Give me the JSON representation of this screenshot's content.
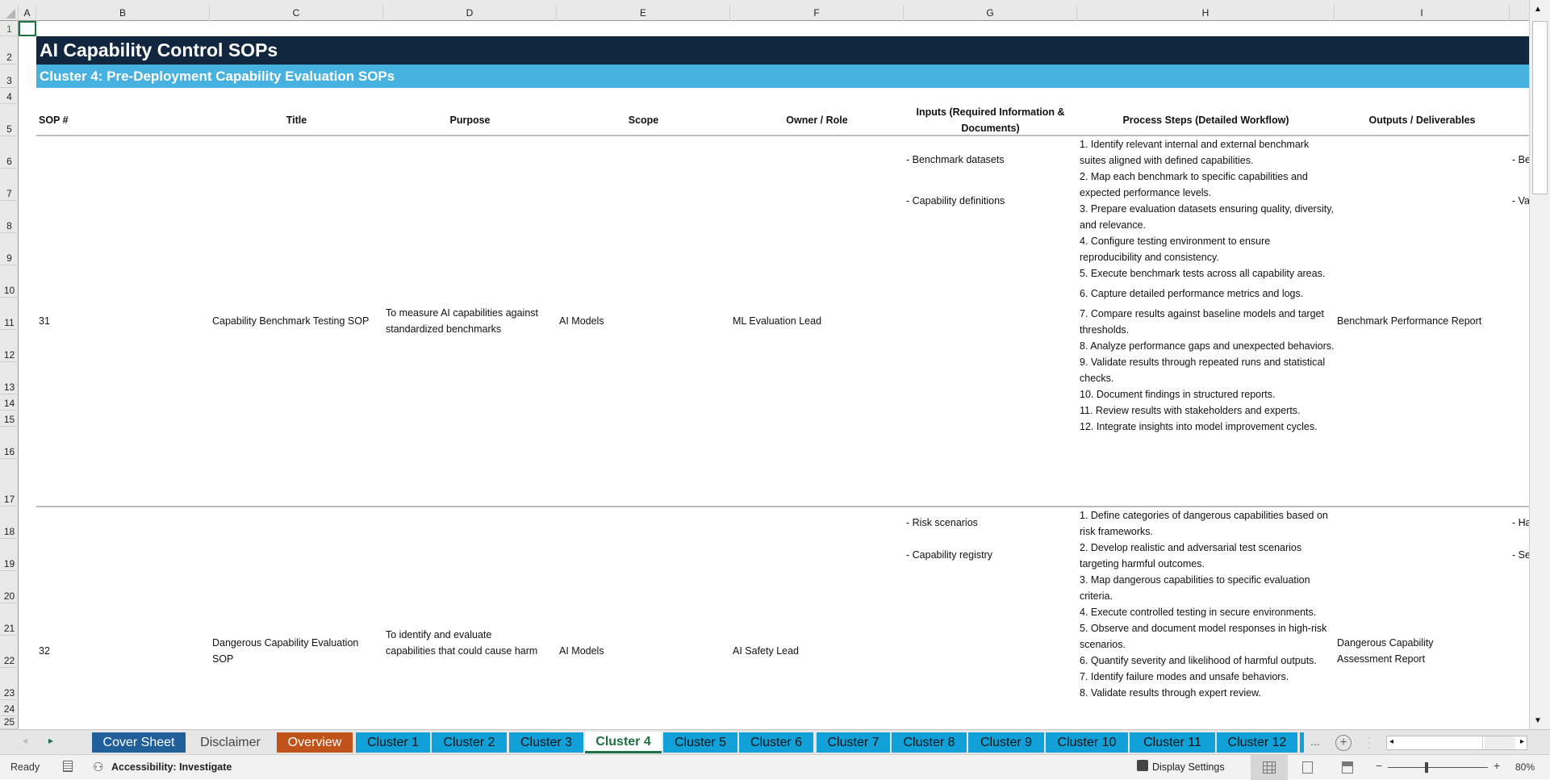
{
  "columns": [
    "A",
    "B",
    "C",
    "D",
    "E",
    "F",
    "G",
    "H",
    "I"
  ],
  "rows": [
    "1",
    "2",
    "3",
    "4",
    "5",
    "6",
    "7",
    "8",
    "9",
    "10",
    "11",
    "12",
    "13",
    "14",
    "15",
    "16",
    "17",
    "18",
    "19",
    "20",
    "21",
    "22",
    "23",
    "24",
    "25"
  ],
  "sheet": {
    "title": "AI Capability Control SOPs",
    "subtitle": "Cluster 4: Pre-Deployment Capability Evaluation SOPs",
    "headers": {
      "sop": "SOP #",
      "title": "Title",
      "purpose": "Purpose",
      "scope": "Scope",
      "owner": "Owner / Role",
      "inputs": "Inputs (Required Information & Documents)",
      "steps": "Process Steps (Detailed Workflow)",
      "outputs": "Outputs / Deliverables"
    },
    "records": [
      {
        "sop": "31",
        "title": "Capability Benchmark Testing SOP",
        "purpose": "To measure AI capabilities against standardized benchmarks",
        "scope": "AI Models",
        "owner": "ML Evaluation Lead",
        "inputs": [
          "- Benchmark datasets",
          "- Capability definitions"
        ],
        "steps": [
          "1. Identify relevant internal and external benchmark suites aligned with defined capabilities.",
          "2. Map each benchmark to specific capabilities and expected performance levels.",
          "3. Prepare evaluation datasets ensuring quality, diversity, and relevance.",
          "4. Configure testing environment to ensure reproducibility and consistency.",
          "5. Execute benchmark tests across all capability areas.",
          "6. Capture detailed performance metrics and logs.",
          "7. Compare results against baseline models and target thresholds.",
          "8. Analyze performance gaps and unexpected behaviors.",
          "9. Validate results through repeated runs and statistical checks.",
          "10. Document findings in structured reports.",
          "11. Review results with stakeholders and experts.",
          "12. Integrate insights into model improvement cycles."
        ],
        "outputs": "Benchmark Performance Report",
        "next_col": [
          "- Be",
          "- Va"
        ]
      },
      {
        "sop": "32",
        "title": "Dangerous Capability Evaluation SOP",
        "purpose": "To identify and evaluate capabilities that could cause harm",
        "scope": "AI Models",
        "owner": "AI Safety Lead",
        "inputs": [
          "- Risk scenarios",
          "- Capability registry"
        ],
        "steps": [
          "1. Define categories of dangerous capabilities based on risk frameworks.",
          "2. Develop realistic and adversarial test scenarios targeting harmful outcomes.",
          "3. Map dangerous capabilities to specific evaluation criteria.",
          "4. Execute controlled testing in secure environments.",
          "5. Observe and document model responses in high-risk scenarios.",
          "6. Quantify severity and likelihood of harmful outputs.",
          "7. Identify failure modes and unsafe behaviors.",
          "8. Validate results through expert review."
        ],
        "outputs": "Dangerous Capability Assessment Report",
        "next_col": [
          "- Ha",
          "- Se"
        ]
      }
    ]
  },
  "tabs": [
    "Cover Sheet",
    "Disclaimer",
    "Overview",
    "Cluster 1",
    "Cluster 2",
    "Cluster 3",
    "Cluster 4",
    "Cluster 5",
    "Cluster 6",
    "Cluster 7",
    "Cluster 8",
    "Cluster 9",
    "Cluster 10",
    "Cluster 11",
    "Cluster 12"
  ],
  "tabs_more": "...",
  "status": {
    "ready": "Ready",
    "accessibility": "Accessibility: Investigate",
    "display_settings": "Display Settings",
    "zoom": "80%"
  },
  "colors": {
    "title_band": "#10273f",
    "subtitle_band": "#47b1e0",
    "tab_cluster": "#12a0d8",
    "tab_cover": "#215f9a",
    "tab_overview": "#c0521a",
    "active": "#1e7145"
  }
}
